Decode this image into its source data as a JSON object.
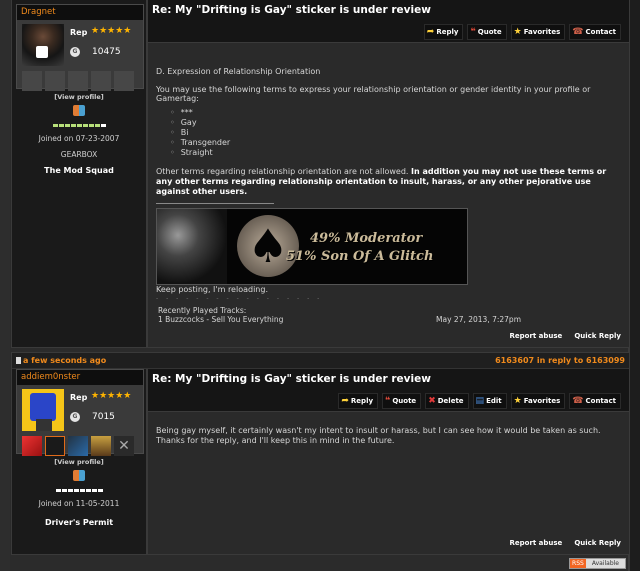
{
  "posts": [
    {
      "header": null,
      "user": {
        "name": "Dragnet",
        "rep_label": "Rep",
        "stars": "★★★★★",
        "gamerscore_icon": "G",
        "gamerscore": "10475",
        "view_profile": "[View profile]",
        "rank_fill": 8,
        "rank_total": 9,
        "joined": "Joined on 07-23-2007",
        "subtitle": "GEARBOX",
        "group": "The Mod Squad"
      },
      "title": "Re: My \"Drifting is Gay\" sticker is under review",
      "actions": [
        {
          "icon": "reply-icon",
          "glyph": "➦",
          "label": "Reply"
        },
        {
          "icon": "quote-icon",
          "glyph": "❝",
          "label": "Quote"
        },
        {
          "icon": "star-icon",
          "glyph": "★",
          "label": "Favorites"
        },
        {
          "icon": "contact-icon",
          "glyph": "☎",
          "label": "Contact"
        }
      ],
      "body": {
        "heading": "D. Expression of Relationship Orientation",
        "intro": "You may use the following terms to express your relationship orientation or gender identity in your profile or Gamertag:",
        "terms": [
          "***",
          "Gay",
          "Bi",
          "Transgender",
          "Straight"
        ],
        "other_normal": "Other terms regarding relationship orientation are not allowed. ",
        "other_bold": "In addition you may not use these terms or any other terms regarding relationship orientation to insult, harass, or any other pejorative use against other users."
      },
      "signature": {
        "banner_line1": "49% Moderator",
        "banner_line2": "51% Son Of A Glitch",
        "tagline": "Keep posting, I'm reloading.",
        "dots": "- - - - - - - - - - - - - - - - -",
        "tracks_label": "Recently Played Tracks:",
        "track": "1 Buzzcocks  - Sell You Everything",
        "track_date": "May 27, 2013, 7:27pm"
      },
      "footer": {
        "report": "Report abuse",
        "quick_reply": "Quick Reply"
      }
    },
    {
      "header": {
        "time": "a few seconds ago",
        "reply_info": "6163607 in reply to 6163099"
      },
      "user": {
        "name": "addiem0nster",
        "rep_label": "Rep",
        "stars": "★★★★★",
        "gamerscore_icon": "G",
        "gamerscore": "7015",
        "view_profile": "[View profile]",
        "rank_fill": 0,
        "rank_total": 8,
        "joined": "Joined on 11-05-2011",
        "subtitle": "",
        "group": "Driver's Permit"
      },
      "title": "Re: My \"Drifting is Gay\" sticker is under review",
      "actions": [
        {
          "icon": "reply-icon",
          "glyph": "➦",
          "label": "Reply"
        },
        {
          "icon": "quote-icon",
          "glyph": "❝",
          "label": "Quote"
        },
        {
          "icon": "delete-icon",
          "glyph": "✖",
          "label": "Delete"
        },
        {
          "icon": "edit-icon",
          "glyph": "▤",
          "label": "Edit"
        },
        {
          "icon": "star-icon",
          "glyph": "★",
          "label": "Favorites"
        },
        {
          "icon": "contact-icon",
          "glyph": "☎",
          "label": "Contact"
        }
      ],
      "body": {
        "text": "Being gay myself, it certainly wasn't my intent to insult or harass, but I can see how it would be taken as such. Thanks for the reply, and I'll keep this in mind in the future."
      },
      "footer": {
        "report": "Report abuse",
        "quick_reply": "Quick Reply"
      }
    }
  ],
  "rss": {
    "badge": "RSS",
    "label": "Available"
  },
  "colors": {
    "accent": "#f08a1c",
    "star": "#ffb400",
    "rank_green": "#b7e07a"
  }
}
